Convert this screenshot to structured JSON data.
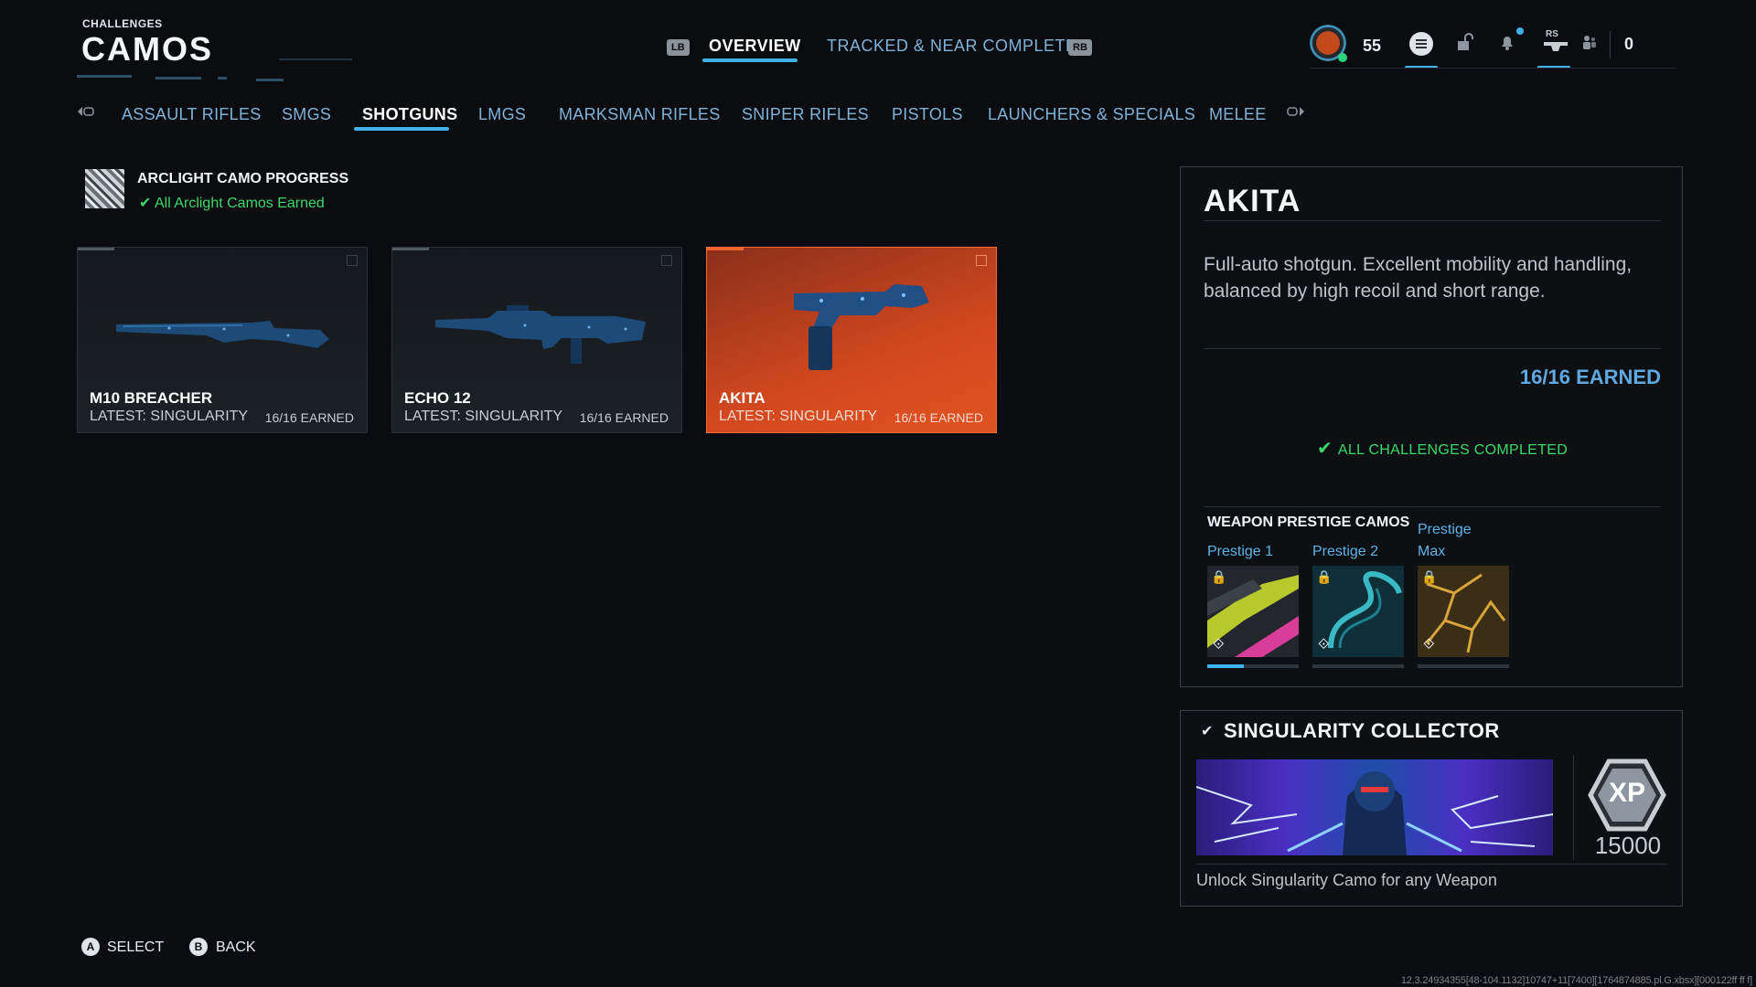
{
  "header": {
    "breadcrumb": "CHALLENGES",
    "title": "CAMOS",
    "left_bumper": "LB",
    "right_bumper": "RB",
    "tabs": [
      {
        "label": "OVERVIEW",
        "active": true
      },
      {
        "label": "TRACKED & NEAR COMPLETE",
        "active": false
      }
    ]
  },
  "status": {
    "level": "55",
    "rs_label": "RS",
    "currency": "0"
  },
  "categories": {
    "left_bumper": "LB",
    "right_bumper": "RB",
    "items": [
      {
        "label": "ASSAULT RIFLES",
        "active": false
      },
      {
        "label": "SMGS",
        "active": false
      },
      {
        "label": "SHOTGUNS",
        "active": true
      },
      {
        "label": "LMGS",
        "active": false
      },
      {
        "label": "MARKSMAN RIFLES",
        "active": false
      },
      {
        "label": "SNIPER RIFLES",
        "active": false
      },
      {
        "label": "PISTOLS",
        "active": false
      },
      {
        "label": "LAUNCHERS & SPECIALS",
        "active": false
      },
      {
        "label": "MELEE",
        "active": false
      }
    ]
  },
  "arclight": {
    "title": "ARCLIGHT CAMO PROGRESS",
    "status": "All Arclight Camos Earned"
  },
  "weapons": [
    {
      "name": "M10 BREACHER",
      "latest": "LATEST: SINGULARITY",
      "earned": "16/16 EARNED",
      "selected": false
    },
    {
      "name": "ECHO 12",
      "latest": "LATEST: SINGULARITY",
      "earned": "16/16 EARNED",
      "selected": false
    },
    {
      "name": "AKITA",
      "latest": "LATEST: SINGULARITY",
      "earned": "16/16 EARNED",
      "selected": true
    }
  ],
  "detail": {
    "name": "AKITA",
    "description": "Full-auto shotgun. Excellent mobility and handling, balanced by high recoil and short range.",
    "earned": "16/16 EARNED",
    "complete": "ALL CHALLENGES COMPLETED",
    "prestige_heading": "WEAPON PRESTIGE CAMOS",
    "prestige": [
      {
        "label": "Prestige 1",
        "progress": 0.4
      },
      {
        "label": "Prestige 2",
        "progress": 0
      },
      {
        "label": "Prestige Max",
        "progress": 0
      }
    ]
  },
  "challenge": {
    "title": "SINGULARITY COLLECTOR",
    "xp_label": "XP",
    "xp_amount": "15000",
    "description": "Unlock Singularity Camo for any Weapon"
  },
  "footer": {
    "select_button": "A",
    "select_label": "SELECT",
    "back_button": "B",
    "back_label": "BACK"
  },
  "build_info": "12.3.24934355[48-104.1132]10747+11[7400][1764874885.pl.G.xbsx][000122ff ff f]",
  "colors": {
    "accent": "#3fb2ea",
    "selected_card": "#d2481f",
    "complete_green": "#3bd96a",
    "earned_blue": "#5fa8e0"
  }
}
